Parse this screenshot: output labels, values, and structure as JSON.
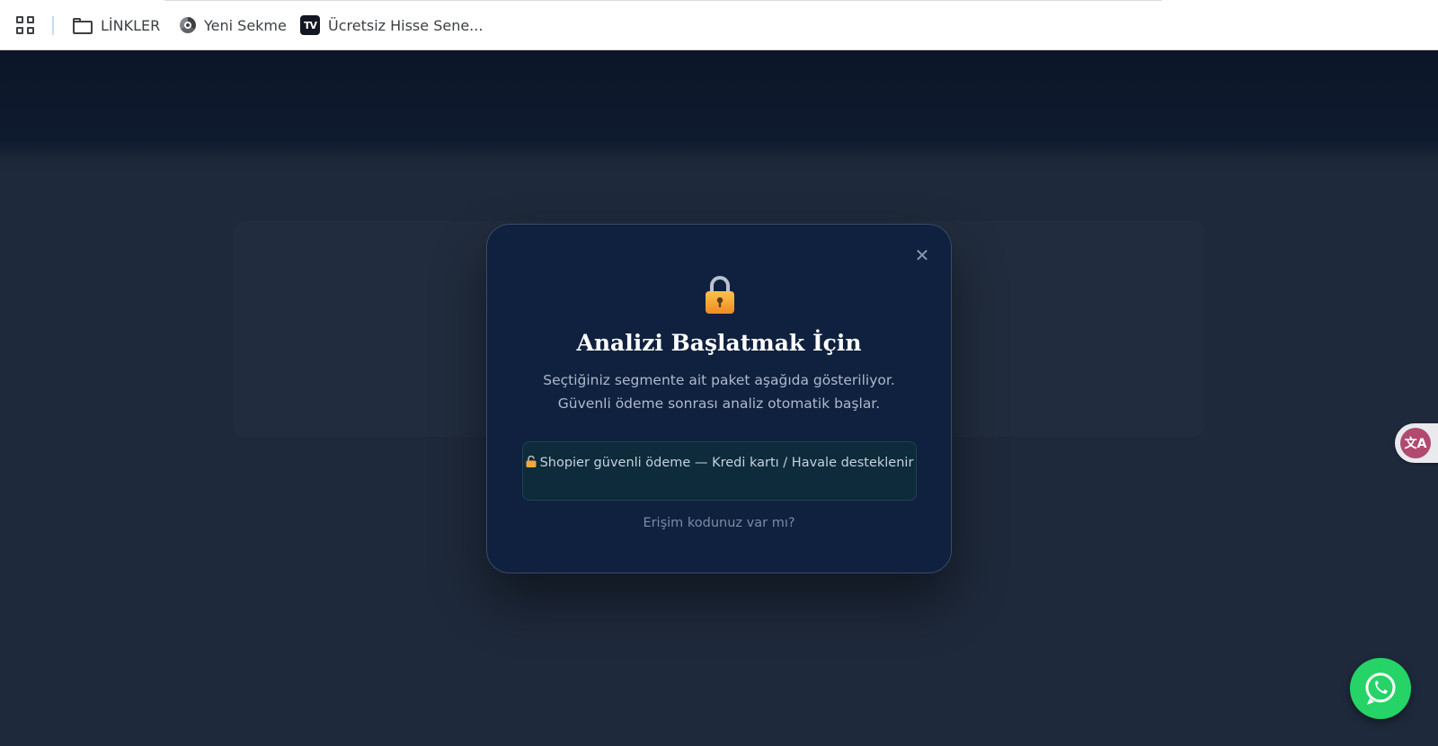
{
  "bookmarks": [
    {
      "label": "LİNKLER",
      "icon": "folder-icon"
    },
    {
      "label": "Yeni Sekme",
      "icon": "chrome-icon"
    },
    {
      "label": "Ücretsiz Hisse Sene...",
      "icon": "tradingview-icon"
    }
  ],
  "modal": {
    "close": "✕",
    "title": "Analizi Başlatmak İçin",
    "desc_line1": "Seçtiğiniz segmente ait paket aşağıda gösteriliyor.",
    "desc_line2": "Güvenli ödeme sonrası analiz otomatik başlar.",
    "payment_info": "Shopier güvenli ödeme — Kredi kartı / Havale desteklenir",
    "access_code_link": "Erişim kodunuz var mı?"
  },
  "colors": {
    "page_bg": "#1e293b",
    "modal_bg": "#0f213f",
    "whatsapp": "#25d366"
  }
}
